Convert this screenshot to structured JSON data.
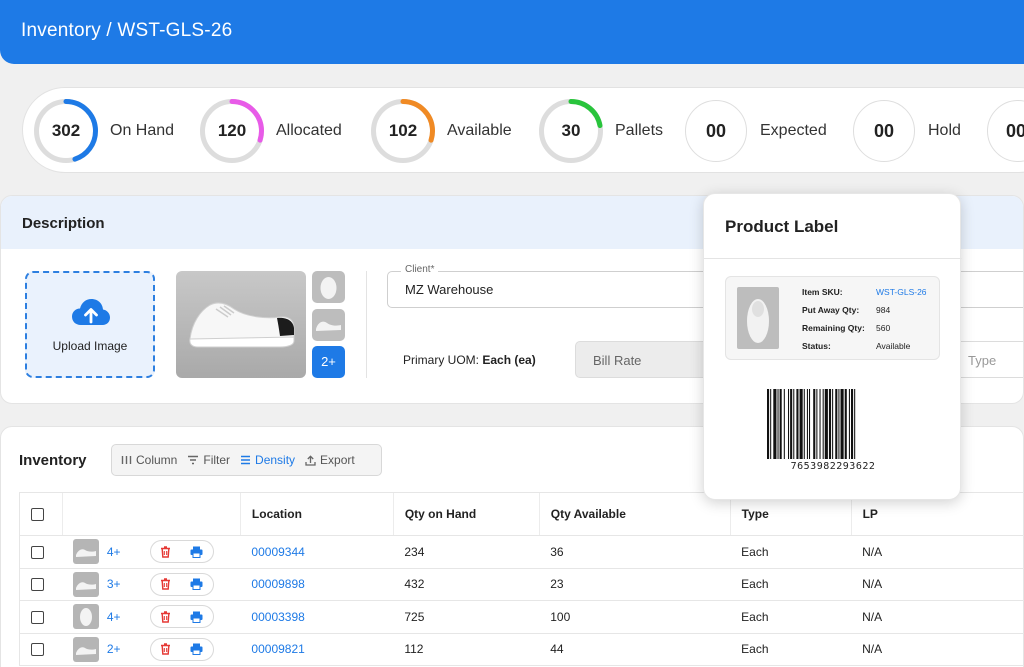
{
  "header": {
    "breadcrumb": "Inventory / WST-GLS-26"
  },
  "stats": [
    {
      "value": "302",
      "label": "On Hand",
      "color": "#1e7ae6",
      "progress": 0.45
    },
    {
      "value": "120",
      "label": "Allocated",
      "color": "#e85be8",
      "progress": 0.3
    },
    {
      "value": "102",
      "label": "Available",
      "color": "#f08a24",
      "progress": 0.3
    },
    {
      "value": "30",
      "label": "Pallets",
      "color": "#29c43c",
      "progress": 0.22
    },
    {
      "value": "00",
      "label": "Expected"
    },
    {
      "value": "00",
      "label": "Hold"
    },
    {
      "value": "00",
      "label": ""
    }
  ],
  "description": {
    "title": "Description",
    "upload_label": "Upload Image",
    "more_images": "2+",
    "client_label": "Client*",
    "client_value": "MZ Warehouse",
    "uom_label": "Primary UOM:",
    "uom_value": "Each (ea)",
    "bill_rate_placeholder": "Bill Rate",
    "type_placeholder": "Type"
  },
  "inventory": {
    "title": "Inventory",
    "toolbar": {
      "column": "Column",
      "filter": "Filter",
      "density": "Density",
      "export": "Export"
    },
    "columns": [
      "",
      "",
      "Location",
      "Qty on Hand",
      "Qty Available",
      "Type",
      "LP"
    ],
    "rows": [
      {
        "count": "4+",
        "location": "00009344",
        "qty_on_hand": "234",
        "qty_available": "36",
        "type": "Each",
        "lp": "N/A"
      },
      {
        "count": "3+",
        "location": "00009898",
        "qty_on_hand": "432",
        "qty_available": "23",
        "type": "Each",
        "lp": "N/A"
      },
      {
        "count": "4+",
        "location": "00003398",
        "qty_on_hand": "725",
        "qty_available": "100",
        "type": "Each",
        "lp": "N/A"
      },
      {
        "count": "2+",
        "location": "00009821",
        "qty_on_hand": "112",
        "qty_available": "44",
        "type": "Each",
        "lp": "N/A"
      }
    ]
  },
  "product_label": {
    "title": "Product Label",
    "sku_label": "Item SKU:",
    "sku_value": "WST-GLS-26",
    "putaway_label": "Put Away Qty:",
    "putaway_value": "984",
    "remaining_label": "Remaining Qty:",
    "remaining_value": "560",
    "status_label": "Status:",
    "status_value": "Available",
    "barcode_number": "7653982293622"
  },
  "colors": {
    "primary": "#1e7ae6",
    "danger": "#e53935"
  }
}
